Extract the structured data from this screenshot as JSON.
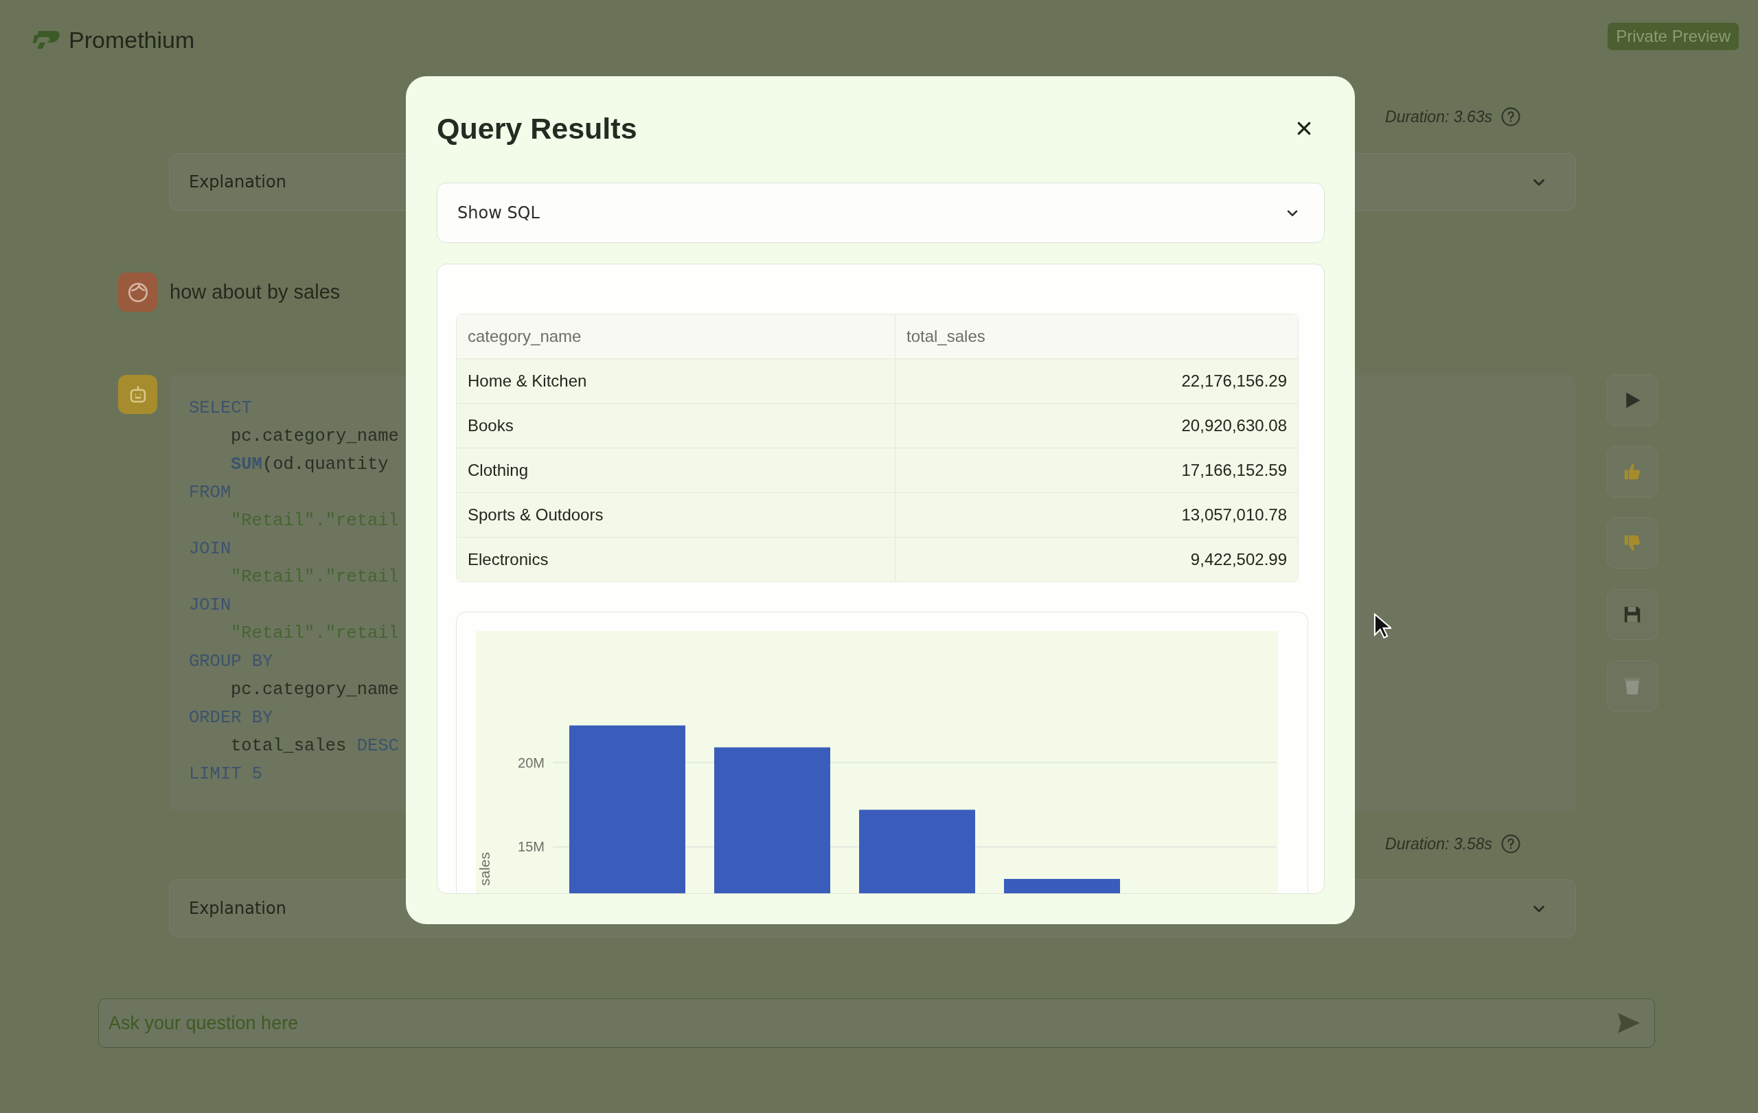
{
  "header": {
    "logo_text": "Promethium",
    "badge": "Private Preview"
  },
  "first_response": {
    "duration": "Duration: 3.63s",
    "explanation": {
      "label": "Explanation",
      "expanded": false
    }
  },
  "user_message": {
    "text": "how about by sales"
  },
  "bot_response": {
    "sql_lines": [
      [
        {
          "kind": "keyword",
          "text": "SELECT"
        }
      ],
      [
        {
          "kind": "indent"
        },
        {
          "kind": "plain",
          "text": "pc.category_name"
        }
      ],
      [
        {
          "kind": "indent"
        },
        {
          "kind": "function",
          "text": "SUM"
        },
        {
          "kind": "plain",
          "text": "(od.quantity"
        }
      ],
      [
        {
          "kind": "keyword",
          "text": "FROM"
        }
      ],
      [
        {
          "kind": "indent"
        },
        {
          "kind": "string",
          "text": "\"Retail\".\"retail"
        }
      ],
      [
        {
          "kind": "keyword",
          "text": "JOIN"
        }
      ],
      [
        {
          "kind": "indent"
        },
        {
          "kind": "string",
          "text": "\"Retail\".\"retail"
        }
      ],
      [
        {
          "kind": "keyword",
          "text": "JOIN"
        }
      ],
      [
        {
          "kind": "indent"
        },
        {
          "kind": "string",
          "text": "\"Retail\".\"retail"
        }
      ],
      [
        {
          "kind": "keyword",
          "text": "GROUP BY"
        }
      ],
      [
        {
          "kind": "indent"
        },
        {
          "kind": "plain",
          "text": "pc.category_name"
        }
      ],
      [
        {
          "kind": "keyword",
          "text": "ORDER BY"
        }
      ],
      [
        {
          "kind": "indent"
        },
        {
          "kind": "plain",
          "text": "total_sales "
        },
        {
          "kind": "keyword",
          "text": "DESC"
        }
      ],
      [
        {
          "kind": "keyword",
          "text": "LIMIT"
        },
        {
          "kind": "number",
          "text": " 5"
        }
      ]
    ],
    "actions": [
      {
        "kind": "run"
      },
      {
        "kind": "thumbs_up"
      },
      {
        "kind": "thumbs_down"
      },
      {
        "kind": "save"
      },
      {
        "kind": "delete"
      }
    ],
    "duration": "Duration: 3.58s",
    "explanation": {
      "label": "Explanation",
      "expanded": false
    }
  },
  "input": {
    "placeholder": "Ask your question here"
  },
  "modal": {
    "title": "Query Results",
    "sql_toggle": {
      "label": "Show SQL",
      "expanded": false
    },
    "table": {
      "columns": [
        "category_name",
        "total_sales"
      ],
      "rows": [
        [
          "Home & Kitchen",
          "22,176,156.29"
        ],
        [
          "Books",
          "20,920,630.08"
        ],
        [
          "Clothing",
          "17,166,152.59"
        ],
        [
          "Sports & Outdoors",
          "13,057,010.78"
        ],
        [
          "Electronics",
          "9,422,502.99"
        ]
      ]
    },
    "chart_data": {
      "type": "bar",
      "ylabel": "sales",
      "ylim": [
        11800000,
        27800000
      ],
      "yticks": [
        {
          "value": 15000000,
          "label": "15M"
        },
        {
          "value": 20000000,
          "label": "20M"
        }
      ],
      "series": [
        {
          "color": "#3a5dbb",
          "values": [
            22200000,
            20900000,
            17200000,
            13100000
          ]
        }
      ]
    }
  }
}
